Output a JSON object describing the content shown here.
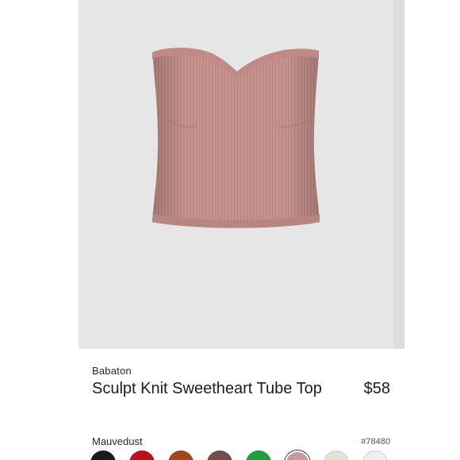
{
  "product": {
    "brand": "Babaton",
    "title": "Sculpt Knit Sweetheart Tube Top",
    "price": "$58",
    "color_name": "Mauvedust",
    "style_number": "#78480",
    "image": "pink-ribbed-strapless-tube-top"
  },
  "swatches": [
    {
      "name": "black",
      "color": "#1a1a1a"
    },
    {
      "name": "red",
      "color": "#b5121b"
    },
    {
      "name": "rust",
      "color": "#a0471f"
    },
    {
      "name": "brown",
      "color": "#6e4f49"
    },
    {
      "name": "green",
      "color": "#1e9e3e"
    },
    {
      "name": "mauvedust",
      "color": "#c59c9b",
      "selected": true
    },
    {
      "name": "sage",
      "color": "#dfe3d2"
    },
    {
      "name": "light-grey",
      "color": "#efefef"
    }
  ],
  "colors": {
    "image_background": "#e6e6e6",
    "garment": "#c8948f"
  }
}
